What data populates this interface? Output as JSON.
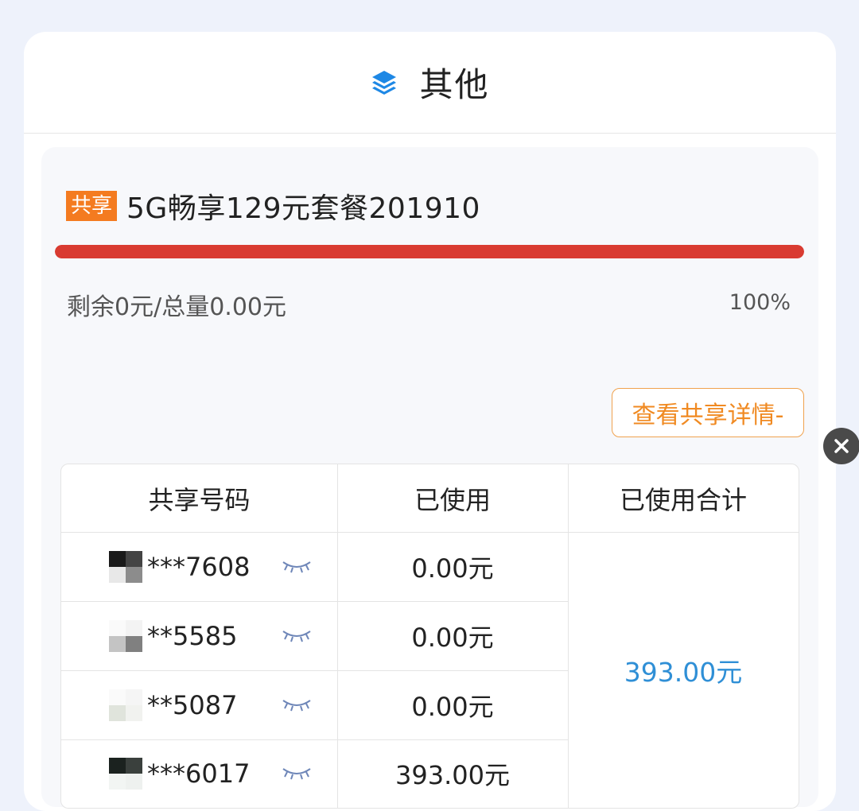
{
  "header": {
    "title": "其他",
    "icon": "layers-icon"
  },
  "plan": {
    "badge": "共享",
    "name": "5G畅享129元套餐201910",
    "progress_percent": 100,
    "remain_text": "剩余0元/总量0.00元",
    "percent_text": "100%",
    "detail_button": "查看共享详情-"
  },
  "table": {
    "headers": [
      "共享号码",
      "已使用",
      "已使用合计"
    ],
    "rows": [
      {
        "number": "***7608",
        "used": "0.00元"
      },
      {
        "number": "**5585",
        "used": "0.00元"
      },
      {
        "number": "**5087",
        "used": "0.00元"
      },
      {
        "number": "***6017",
        "used": "393.00元"
      }
    ],
    "total": "393.00元"
  },
  "colors": {
    "accent_blue": "#2f8fd6",
    "badge_orange": "#f47b20",
    "progress_red": "#d93b31",
    "button_orange": "#f08a22"
  }
}
